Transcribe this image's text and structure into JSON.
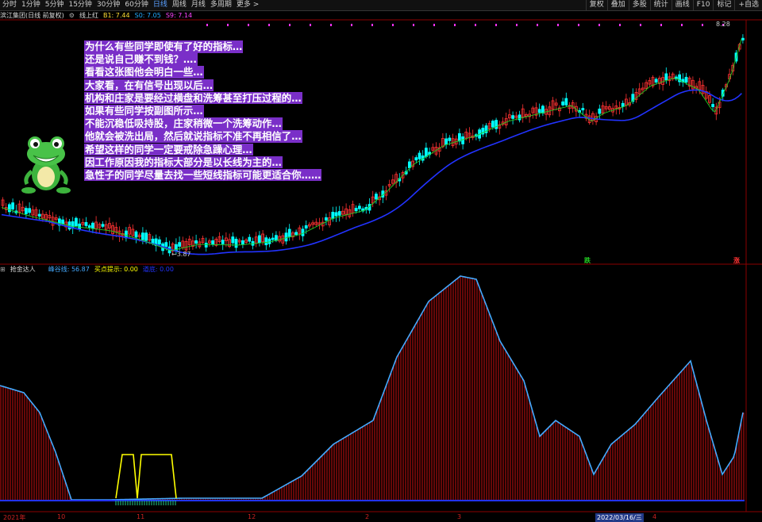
{
  "toolbar": {
    "periods": [
      "分时",
      "1分钟",
      "5分钟",
      "15分钟",
      "30分钟",
      "60分钟",
      "日线",
      "周线",
      "月线",
      "多周期",
      "更多 >"
    ],
    "active_period": "日线",
    "right_items": [
      "复权",
      "叠加",
      "多股",
      "统计",
      "画线",
      "F10",
      "标记",
      "+自选"
    ]
  },
  "infobar": {
    "stock_name": "滨江集团(日线 前复权)",
    "indicator": "线上红",
    "b1": "B1: 7.44",
    "s0": "S0: 7.05",
    "s9": "S9: 7.14"
  },
  "indicator_bar": {
    "name": "抢金达人",
    "feng": "峰谷线: 56.87",
    "buy": "买点提示: 0.00",
    "dao": "道底: 0.00"
  },
  "message_lines": [
    "为什么有些同学即使有了好的指标…",
    "还是说自己赚不到钱？….",
    "看看这张图他会明白一些…",
    "大家看，在有信号出现以后…",
    "机构和庄家是要经过横盘和洗筹甚至打压过程的…",
    "如果有些同学按副图所示…",
    "不能沉稳低吸持股，庄家稍微一个洗筹动作…",
    "他就会被洗出局，然后就说指标不准不再相信了…",
    "希望这样的同学一定要戒除急躁心理…",
    "因工作原因我的指标大部分是以长线为主的…",
    "急性子的同学尽量去找一些短线指标可能更适合你……"
  ],
  "price_high": "8.28",
  "price_low": "3.87",
  "signals": {
    "down": "跌",
    "up": "涨"
  },
  "dates": [
    "2021年",
    "10",
    "11",
    "12",
    "2",
    "3",
    "2022/03/16/三",
    "4"
  ],
  "colors": {
    "up": "#ff3232",
    "down": "#00ffff",
    "ma_fast": "#22cc22",
    "ma_slow": "#2233ff",
    "indicator_line": "#44aaff",
    "bars": "#cc1111",
    "signal": "#ffff00"
  }
}
